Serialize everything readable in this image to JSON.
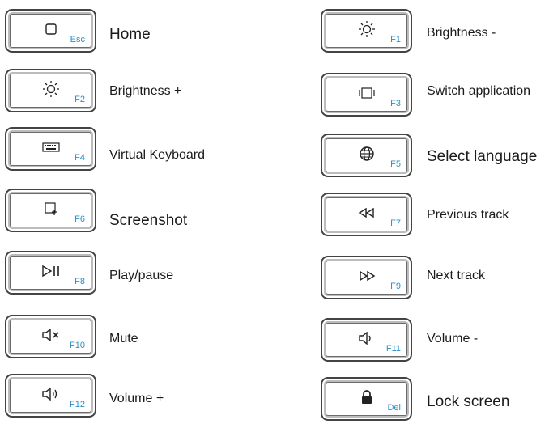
{
  "keys": {
    "esc": {
      "fn": "Esc",
      "label": "Home",
      "icon": "square-icon"
    },
    "f1": {
      "fn": "F1",
      "label": "Brightness -",
      "icon": "brightness-down-icon"
    },
    "f2": {
      "fn": "F2",
      "label": "Brightness +",
      "icon": "brightness-up-icon"
    },
    "f3": {
      "fn": "F3",
      "label": "Switch application",
      "icon": "switch-app-icon"
    },
    "f4": {
      "fn": "F4",
      "label": "Virtual Keyboard",
      "icon": "keyboard-icon"
    },
    "f5": {
      "fn": "F5",
      "label": "Select language",
      "icon": "globe-icon"
    },
    "f6": {
      "fn": "F6",
      "label": "Screenshot",
      "icon": "screenshot-icon"
    },
    "f7": {
      "fn": "F7",
      "label": "Previous track",
      "icon": "previous-track-icon"
    },
    "f8": {
      "fn": "F8",
      "label": "Play/pause",
      "icon": "play-pause-icon"
    },
    "f9": {
      "fn": "F9",
      "label": "Next track",
      "icon": "next-track-icon"
    },
    "f10": {
      "fn": "F10",
      "label": "Mute",
      "icon": "mute-icon"
    },
    "f11": {
      "fn": "F11",
      "label": "Volume -",
      "icon": "volume-down-icon"
    },
    "f12": {
      "fn": "F12",
      "label": "Volume +",
      "icon": "volume-up-icon"
    },
    "del": {
      "fn": "Del",
      "label": "Lock screen",
      "icon": "lock-icon"
    }
  },
  "colors": {
    "fn_label": "#2c8fc9",
    "key_border": "#444444",
    "text": "#1a1a1a"
  }
}
